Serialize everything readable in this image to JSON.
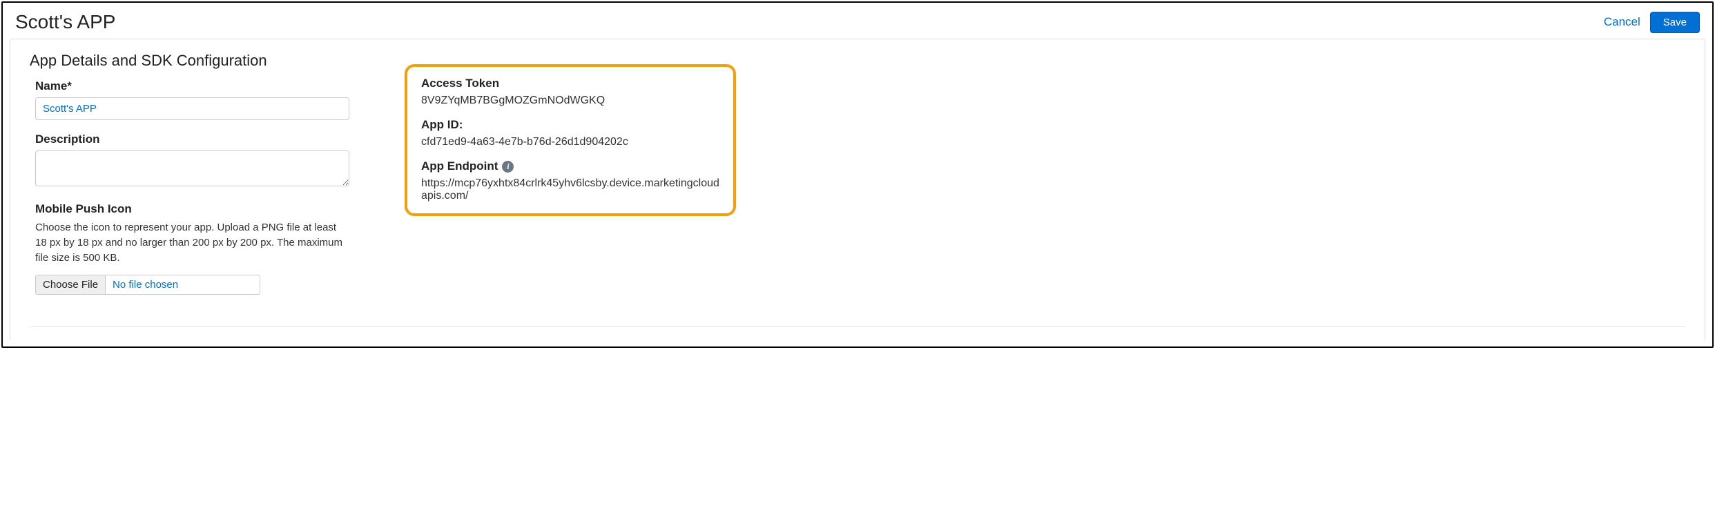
{
  "header": {
    "title": "Scott's APP",
    "cancel_label": "Cancel",
    "save_label": "Save"
  },
  "section": {
    "title": "App Details and SDK Configuration",
    "name_label": "Name*",
    "name_value": "Scott's APP",
    "description_label": "Description",
    "description_value": "",
    "push_icon_label": "Mobile Push Icon",
    "push_icon_help": "Choose the icon to represent your app. Upload a PNG file at least 18 px by 18 px and no larger than 200 px by 200 px. The maximum file size is 500 KB.",
    "choose_file_label": "Choose File",
    "file_status": "No file chosen"
  },
  "credentials": {
    "access_token_label": "Access Token",
    "access_token_value": "8V9ZYqMB7BGgMOZGmNOdWGKQ",
    "app_id_label": "App ID:",
    "app_id_value": "cfd71ed9-4a63-4e7b-b76d-26d1d904202c",
    "app_endpoint_label": "App Endpoint",
    "app_endpoint_value": "https://mcp76yxhtx84crlrk45yhv6lcsby.device.marketingcloudapis.com/"
  }
}
